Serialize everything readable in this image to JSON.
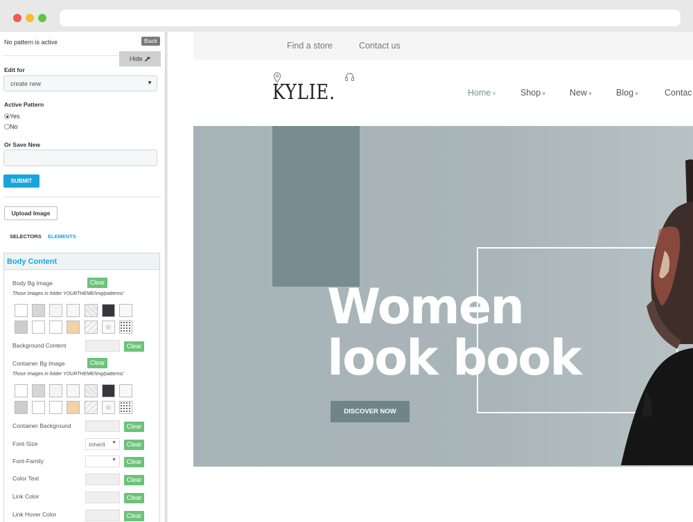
{
  "panel": {
    "status": "No pattern is active",
    "back": "Back",
    "hide": "Hide",
    "edit_for_label": "Edit for",
    "edit_for_value": "create new",
    "active_pattern_label": "Active Pattern",
    "radio_yes": "Yes",
    "radio_no": "No",
    "save_new_label": "Or Save New",
    "submit": "SUBMIT",
    "upload": "Upload Image",
    "tabs": [
      "SELECTORS",
      "ELEMENTS"
    ],
    "section_title": "Body Content",
    "body_bg_image": "Body Bg Image",
    "folder_note": "Those Images in folder YOURTHEME/img/patterns/",
    "background_content": "Background Content",
    "container_bg_image": "Container Bg Image",
    "container_background": "Container Background",
    "font_size": "Font-Size",
    "font_size_value": "Inherit",
    "font_family": "Font-Family",
    "color_text": "Color Text",
    "link_color": "Link Color",
    "link_hover_color": "Link Hover Color",
    "clear": "Clear"
  },
  "site": {
    "find_store": "Find a store",
    "contact_us": "Contact us",
    "logo": "KYLIE.",
    "nav": [
      "Home",
      "Shop",
      "New",
      "Blog",
      "Contac"
    ],
    "headline_1": "Women",
    "headline_2": "look book",
    "cta": "DISCOVER NOW"
  },
  "colors": {
    "accent_blue": "#1aa4de",
    "clear_green": "#6cc27a",
    "hero_bg": "#a9b5b9",
    "hero_rect": "#788b8e"
  }
}
